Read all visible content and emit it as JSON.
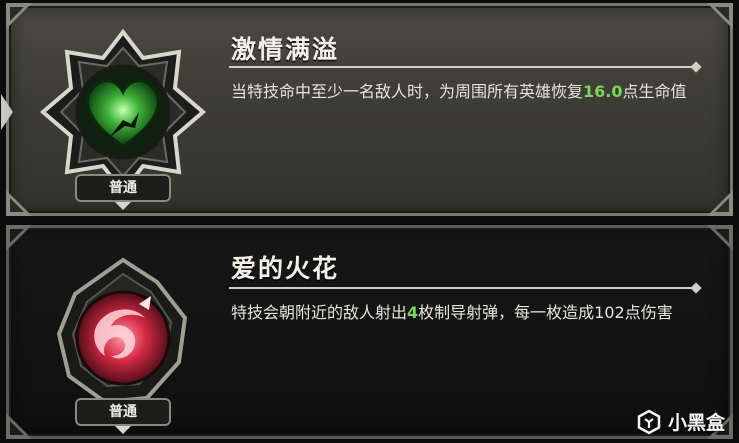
{
  "skills": [
    {
      "name": "激情满溢",
      "desc_pre": "当特技命中至少一名敌人时，为周围所有英雄恢复",
      "desc_value": "16.0",
      "desc_post": "点生命值",
      "rarity": "普通",
      "icon": "green-heart-icon"
    },
    {
      "name": "爱的火花",
      "desc_pre": "特技会朝附近的敌人射出",
      "desc_value": "4",
      "desc_post": "枚制导射弹，每一枚造成102点伤害",
      "rarity": "普通",
      "icon": "red-spark-icon"
    }
  ],
  "watermark": {
    "text": "小黑盒"
  },
  "colors": {
    "highlight": "#78d65a",
    "panel_active": "#3d3d36",
    "panel_dark": "#121213"
  }
}
